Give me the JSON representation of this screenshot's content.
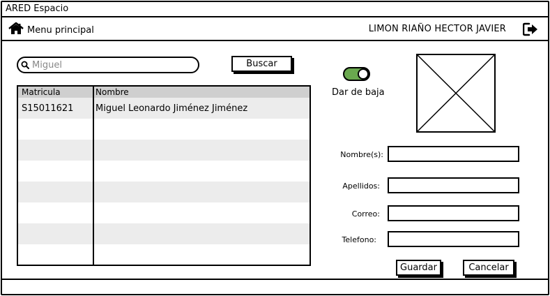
{
  "window": {
    "title": "ARED Espacio"
  },
  "nav": {
    "home_label": "Menu principal",
    "home_icon": "home-icon",
    "user_name": "LIMON RIAÑO HECTOR JAVIER",
    "logout_icon": "logout-icon"
  },
  "search": {
    "value": "Miguel",
    "placeholder": "Miguel",
    "icon": "search-icon",
    "button_label": "Buscar"
  },
  "table": {
    "columns": [
      "Matricula",
      "Nombre"
    ],
    "rows": [
      {
        "matricula": "S15011621",
        "nombre": "Miguel Leonardo Jiménez Jiménez"
      }
    ]
  },
  "toggle": {
    "label": "Dar de baja",
    "on": true,
    "color": "#6aa84f"
  },
  "form": {
    "nombres_label": "Nombre(s):",
    "apellidos_label": "Apellidos:",
    "correo_label": "Correo:",
    "telefono_label": "Telefono:",
    "nombres_value": "",
    "apellidos_value": "",
    "correo_value": "",
    "telefono_value": ""
  },
  "actions": {
    "save_label": "Guardar",
    "cancel_label": "Cancelar"
  }
}
